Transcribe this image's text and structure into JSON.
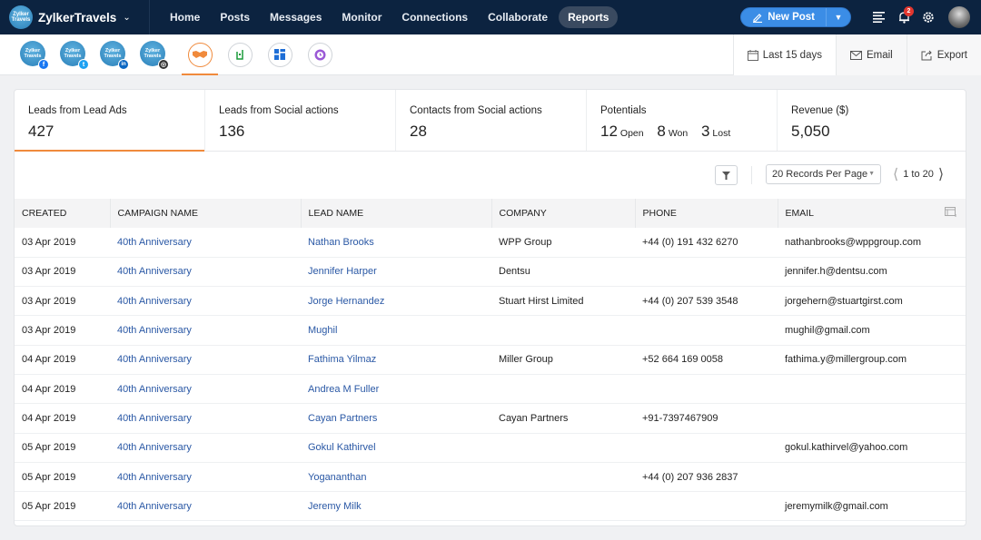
{
  "brand": {
    "name": "ZylkerTravels",
    "logo_text": "Zylker Travels"
  },
  "nav": {
    "items": [
      {
        "label": "Home",
        "active": false
      },
      {
        "label": "Posts",
        "active": false
      },
      {
        "label": "Messages",
        "active": false
      },
      {
        "label": "Monitor",
        "active": false
      },
      {
        "label": "Connections",
        "active": false
      },
      {
        "label": "Collaborate",
        "active": false
      },
      {
        "label": "Reports",
        "active": true
      }
    ],
    "new_post_label": "New Post",
    "notification_count": "2"
  },
  "channels": [
    {
      "name": "Zylker Travels",
      "network": "facebook",
      "glyph": "f",
      "color": "#1877f2"
    },
    {
      "name": "Zylker Travels",
      "network": "twitter",
      "glyph": "t",
      "color": "#1da1f2"
    },
    {
      "name": "Zylker Travels",
      "network": "linkedin",
      "glyph": "in",
      "color": "#0a66c2"
    },
    {
      "name": "Zylker Travels",
      "network": "instagram",
      "glyph": "◎",
      "color": "#333333"
    }
  ],
  "report_tabs": [
    {
      "name": "handshake-icon",
      "active": true
    },
    {
      "name": "crm-icon",
      "active": false
    },
    {
      "name": "dashboard-icon",
      "active": false
    },
    {
      "name": "analytics-icon",
      "active": false
    }
  ],
  "subbar": {
    "date_range": "Last 15 days",
    "email_label": "Email",
    "export_label": "Export"
  },
  "stats": {
    "lead_ads": {
      "label": "Leads from Lead Ads",
      "value": "427"
    },
    "social_actions": {
      "label": "Leads from Social actions",
      "value": "136"
    },
    "contacts_social": {
      "label": "Contacts from Social actions",
      "value": "28"
    },
    "potentials": {
      "label": "Potentials",
      "open": "12",
      "open_label": "Open",
      "won": "8",
      "won_label": "Won",
      "lost": "3",
      "lost_label": "Lost"
    },
    "revenue": {
      "label": "Revenue ($)",
      "value": "5,050"
    }
  },
  "toolbar": {
    "per_page": "20 Records Per Page",
    "page_range": "1 to 20"
  },
  "table": {
    "headers": [
      "CREATED",
      "CAMPAIGN NAME",
      "LEAD NAME",
      "COMPANY",
      "PHONE",
      "EMAIL"
    ],
    "rows": [
      [
        "03 Apr 2019",
        "40th Anniversary",
        "Nathan Brooks",
        "WPP Group",
        "+44 (0) 191 432 6270",
        "nathanbrooks@wppgroup.com"
      ],
      [
        "03 Apr 2019",
        "40th Anniversary",
        "Jennifer Harper",
        "Dentsu",
        "",
        "jennifer.h@dentsu.com"
      ],
      [
        "03 Apr 2019",
        "40th Anniversary",
        "Jorge Hernandez",
        "Stuart Hirst Limited",
        "+44 (0) 207 539 3548",
        "jorgehern@stuartgirst.com"
      ],
      [
        "03 Apr 2019",
        "40th Anniversary",
        "Mughil",
        "",
        "",
        "mughil@gmail.com"
      ],
      [
        "04 Apr 2019",
        "40th Anniversary",
        "Fathima Yilmaz",
        "Miller Group",
        "+52 664 169 0058",
        "fathima.y@millergroup.com"
      ],
      [
        "04 Apr 2019",
        "40th Anniversary",
        "Andrea M Fuller",
        "",
        "",
        ""
      ],
      [
        "04 Apr 2019",
        "40th Anniversary",
        "Cayan Partners",
        "Cayan Partners",
        "+91-7397467909",
        ""
      ],
      [
        "05 Apr 2019",
        "40th Anniversary",
        "Gokul Kathirvel",
        "",
        "",
        "gokul.kathirvel@yahoo.com"
      ],
      [
        "05 Apr 2019",
        "40th Anniversary",
        "Yogananthan",
        "",
        "+44 (0) 207 936 2837",
        ""
      ],
      [
        "05 Apr 2019",
        "40th Anniversary",
        "Jeremy Milk",
        "",
        "",
        "jeremymilk@gmail.com"
      ]
    ]
  },
  "colors": {
    "nav_bg": "#0c2340",
    "accent": "#f08a3c",
    "primary": "#3b8de6",
    "link": "#2a58a5"
  }
}
